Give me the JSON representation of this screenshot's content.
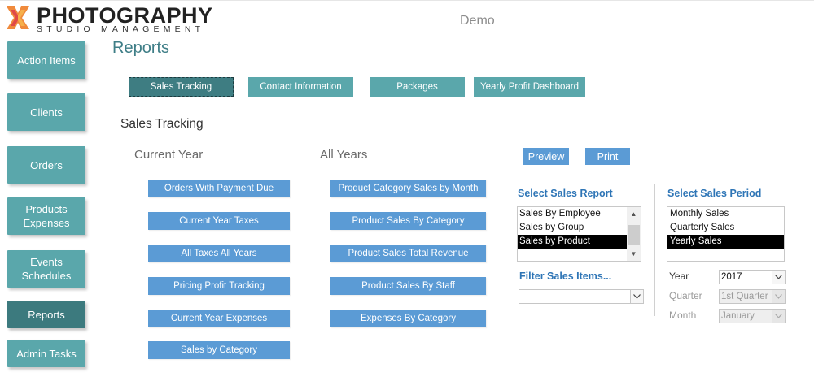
{
  "header": {
    "brand": "PHOTOGRAPHY",
    "tagline": "STUDIO MANAGEMENT",
    "demo_label": "Demo",
    "page_title": "Reports"
  },
  "sidebar": {
    "items": [
      {
        "label": "Action Items"
      },
      {
        "label": "Clients"
      },
      {
        "label": "Orders"
      },
      {
        "label": "Products\nExpenses"
      },
      {
        "label": "Events\nSchedules"
      },
      {
        "label": "Reports"
      },
      {
        "label": "Admin Tasks"
      }
    ]
  },
  "tabs": [
    {
      "label": "Sales Tracking"
    },
    {
      "label": "Contact Information"
    },
    {
      "label": "Packages"
    },
    {
      "label": "Yearly Profit Dashboard"
    }
  ],
  "section_title": "Sales Tracking",
  "current_year": {
    "heading": "Current Year",
    "buttons": [
      "Orders With Payment Due",
      "Current Year Taxes",
      "All Taxes All Years",
      "Pricing Profit Tracking",
      "Current Year Expenses",
      "Sales by Category"
    ]
  },
  "all_years": {
    "heading": "All Years",
    "buttons": [
      "Product Category Sales by Month",
      "Product Sales By Category",
      "Product Sales Total Revenue",
      "Product Sales By Staff",
      "Expenses By Category"
    ]
  },
  "actions": {
    "preview": "Preview",
    "print": "Print"
  },
  "sales_report": {
    "label": "Select Sales Report",
    "options": [
      "Sales By Employee",
      "Sales by Group",
      "Sales by Product"
    ],
    "selected": "Sales by Product"
  },
  "filter": {
    "label": "Filter Sales Items...",
    "value": ""
  },
  "sales_period": {
    "label": "Select Sales Period",
    "options": [
      "Monthly Sales",
      "Quarterly Sales",
      "Yearly Sales"
    ],
    "selected": "Yearly Sales",
    "year_label": "Year",
    "year_value": "2017",
    "quarter_label": "Quarter",
    "quarter_value": "1st Quarter",
    "month_label": "Month",
    "month_value": "January"
  },
  "colors": {
    "sidebar": "#5aa7ab",
    "sidebar_active": "#3c7a7e",
    "report_button": "#5b9bd5",
    "label_blue": "#2e75b6",
    "logo_orange": "#f08a3c",
    "logo_red": "#e04848"
  },
  "icons": {
    "logo": "x-shaped-logo-icon",
    "dropdown": "chevron-down-icon",
    "scroll_up": "arrow-up-icon",
    "scroll_down": "arrow-down-icon"
  }
}
